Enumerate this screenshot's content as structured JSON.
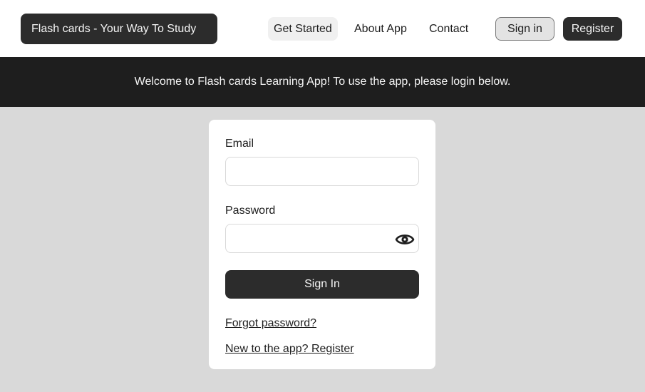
{
  "header": {
    "brand": "Flash cards - Your Way To Study",
    "nav": {
      "get_started": "Get Started",
      "about": "About App",
      "contact": "Contact"
    },
    "sign_in": "Sign in",
    "register": "Register"
  },
  "banner": {
    "text": "Welcome to Flash cards Learning App! To use the app, please login below."
  },
  "form": {
    "email_label": "Email",
    "email_value": "",
    "password_label": "Password",
    "password_value": "",
    "toggle_icon": "eye-icon",
    "submit": "Sign In",
    "forgot": "Forgot password?",
    "new_user": "New to the app? Register"
  },
  "colors": {
    "dark": "#2c2c2c",
    "banner": "#1e1e1e",
    "page_bg": "#d9d9d9"
  }
}
